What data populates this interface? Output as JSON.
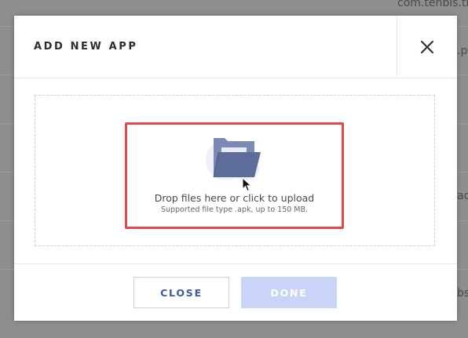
{
  "background": {
    "row_texts": [
      "com.tenbis.tb",
      ".pt",
      "ad",
      "bs"
    ]
  },
  "modal": {
    "title": "ADD NEW APP",
    "close_icon": "close-x-icon",
    "dropzone": {
      "main_text": "Drop files here or click to upload",
      "sub_text": "Supported file type .apk, up to 150 MB.",
      "icon": "folder-icon"
    },
    "buttons": {
      "close_label": "CLOSE",
      "done_label": "DONE"
    }
  },
  "colors": {
    "accent": "#3c57a6",
    "done_disabled": "#c9d4f7",
    "highlight": "#e04a4a",
    "folder": "#6b7aa8"
  }
}
